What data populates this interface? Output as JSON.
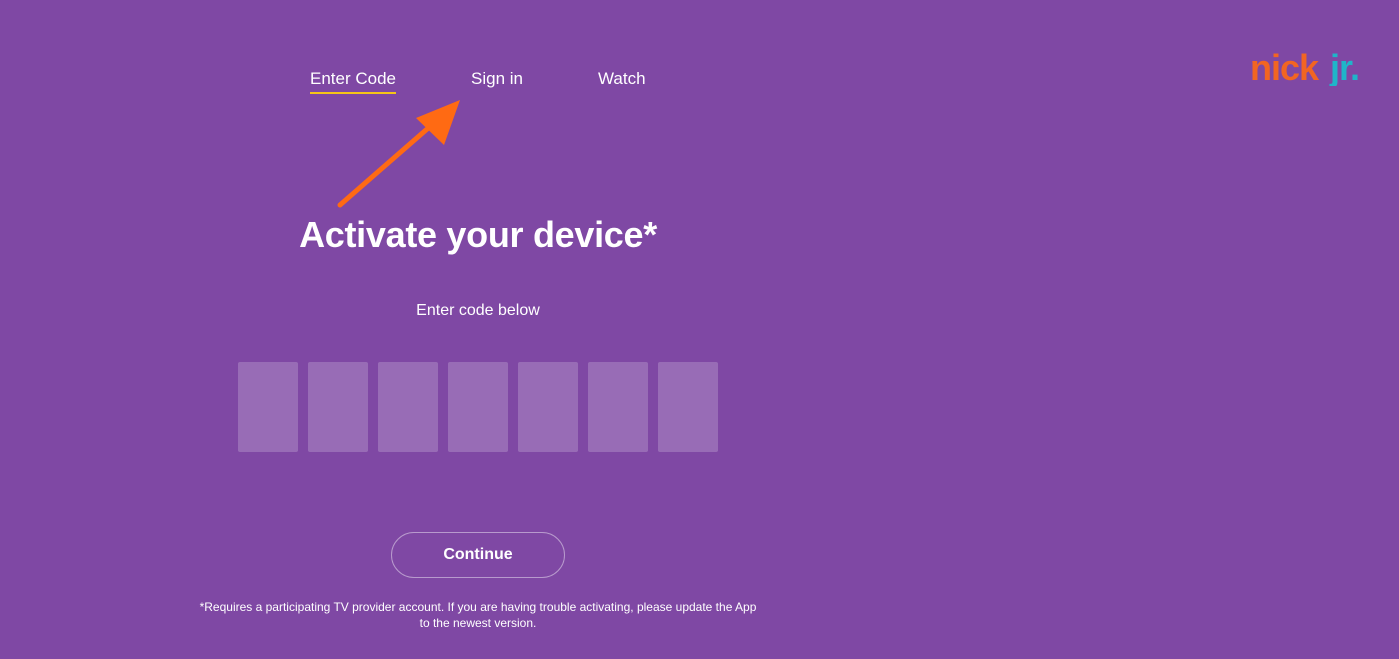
{
  "nav": {
    "tabs": [
      {
        "label": "Enter Code",
        "active": true
      },
      {
        "label": "Sign in",
        "active": false
      },
      {
        "label": "Watch",
        "active": false
      }
    ]
  },
  "logo": {
    "text_part1": "nick",
    "text_part2": "jr.",
    "color_part1": "#f26522",
    "color_part2": "#1fb5c9"
  },
  "annotation": {
    "arrow_color": "#ff6a13"
  },
  "main": {
    "title": "Activate your device*",
    "subtitle": "Enter code below",
    "code_boxes": [
      "",
      "",
      "",
      "",
      "",
      "",
      ""
    ],
    "continue_label": "Continue",
    "disclaimer_line1": "*Requires a participating TV provider account. If you are having trouble activating, please update the App",
    "disclaimer_line2": "to the newest version."
  },
  "colors": {
    "background": "#7f48a4",
    "tab_underline": "#f5c518"
  }
}
